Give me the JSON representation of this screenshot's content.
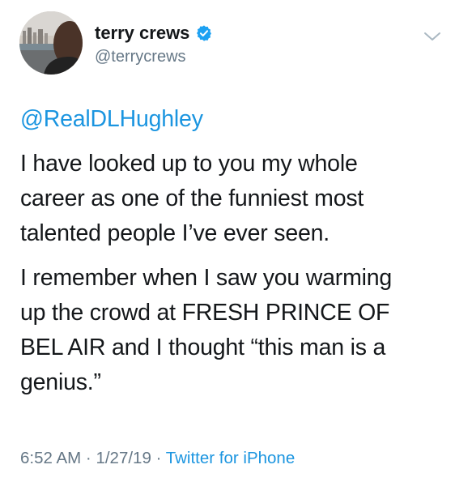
{
  "author": {
    "display_name": "terry crews",
    "handle": "@terrycrews",
    "verified_icon": "verified-badge-icon"
  },
  "tweet": {
    "mention": "@RealDLHughley",
    "paragraphs": [
      "I have looked up to you my whole\ncareer as one of the funniest most\ntalented people I’ve ever seen.",
      "I remember when I saw you warming\nup the crowd at FRESH PRINCE OF\nBEL AIR and I thought “this man is a\ngenius.”"
    ],
    "time": "6:52 AM",
    "date": "1/27/19",
    "separator": "·",
    "source": "Twitter for iPhone"
  },
  "menu_icon": "chevron-down-icon",
  "colors": {
    "link": "#1b95e0",
    "secondary": "#657786",
    "text": "#14171a",
    "verified": "#1da1f2"
  }
}
